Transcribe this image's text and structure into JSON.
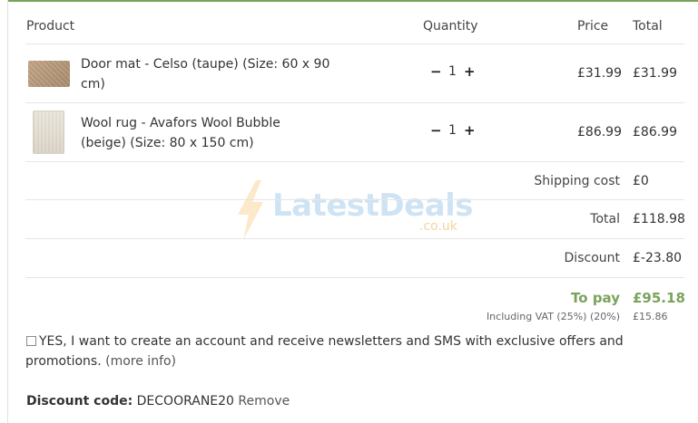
{
  "header": {
    "product": "Product",
    "quantity": "Quantity",
    "price": "Price",
    "total": "Total"
  },
  "items": [
    {
      "name": "Door mat - Celso (taupe) (Size: 60 x 90 cm)",
      "qty": "1",
      "price": "£31.99",
      "total": "£31.99"
    },
    {
      "name": "Wool rug - Avafors Wool Bubble (beige) (Size: 80 x 150 cm)",
      "qty": "1",
      "price": "£86.99",
      "total": "£86.99"
    }
  ],
  "qty_controls": {
    "minus": "−",
    "plus": "+"
  },
  "summary": {
    "shipping_label": "Shipping cost",
    "shipping_value": "£0",
    "total_label": "Total",
    "total_value": "£118.98",
    "discount_label": "Discount",
    "discount_value": "£-23.80",
    "topay_label": "To pay",
    "topay_value": "£95.18",
    "vat_label": "Including VAT (25%) (20%)",
    "vat_value": "£15.86"
  },
  "newsletter": {
    "text_line1": "YES, I want to create an account and receive newsletters and SMS with exclusive offers and",
    "text_line2": "promotions.",
    "more_info": "(more info)",
    "checked": false
  },
  "discount_code": {
    "label": "Discount code:",
    "code": "DECOORANE20",
    "remove": "Remove"
  },
  "watermark": {
    "text": "LatestDeals",
    "sub": ".co.uk"
  },
  "colors": {
    "accent_green": "#7aa35a",
    "divider": "#e6e6e6"
  }
}
